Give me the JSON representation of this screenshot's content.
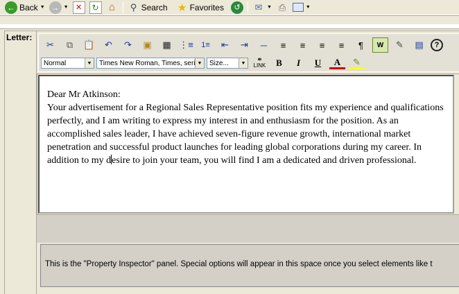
{
  "ie_toolbar": {
    "back_label": "Back",
    "search_label": "Search",
    "favorites_label": "Favorites"
  },
  "letter_label": "Letter:",
  "editor_toolbar": {
    "paragraph_format": "Normal",
    "font_family": "Times New Roman, Times, serif",
    "font_size": "Size...",
    "link_label": "LINK",
    "help_label": "?"
  },
  "document": {
    "greeting": "Dear Mr Atkinson:",
    "body_before_caret": "Your advertisement for a Regional Sales Representative position fits my experience and qualifications perfectly, and I am writing to express my interest in and enthusiasm for the position. As an accomplished sales leader, I have achieved seven-figure revenue growth, international market penetration and successful product launches for leading global corporations during my career. In addition to my d",
    "body_after_caret": "esire to join your team, you will find I am a dedicated and driven professional."
  },
  "property_inspector": {
    "text": "This is the \"Property Inspector\" panel. Special options will appear in this space once you select elements like t"
  }
}
